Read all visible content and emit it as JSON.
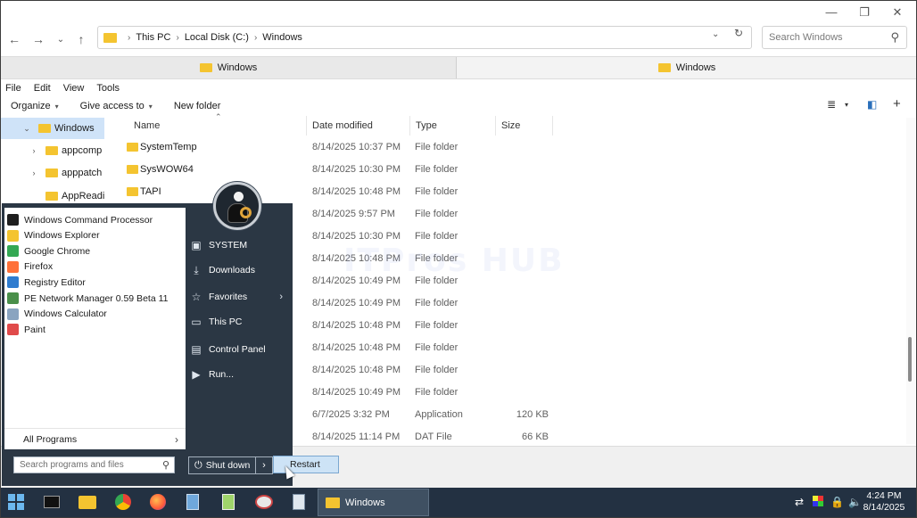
{
  "explorer": {
    "window_controls": [
      "minimize",
      "restore",
      "close"
    ],
    "breadcrumb": [
      "This PC",
      "Local Disk (C:)",
      "Windows"
    ],
    "search_placeholder": "Search Windows",
    "tabs": [
      {
        "label": "Windows",
        "active": true
      },
      {
        "label": "Windows",
        "active": false
      }
    ],
    "menu": [
      "File",
      "Edit",
      "View",
      "Tools"
    ],
    "commands": {
      "organize": "Organize",
      "give_access": "Give access to",
      "new_folder": "New folder"
    },
    "nav_items": [
      {
        "label": "Windows",
        "expanded": true,
        "selected": true
      },
      {
        "label": "appcomp",
        "expanded": false,
        "selected": false
      },
      {
        "label": "apppatch",
        "expanded": false,
        "selected": false
      },
      {
        "label": "AppReadi",
        "expanded": false,
        "selected": false
      }
    ],
    "columns": [
      "Name",
      "Date modified",
      "Type",
      "Size"
    ],
    "rows": [
      {
        "name": "SystemTemp",
        "date": "8/14/2025 10:37 PM",
        "type": "File folder",
        "size": ""
      },
      {
        "name": "SysWOW64",
        "date": "8/14/2025 10:30 PM",
        "type": "File folder",
        "size": ""
      },
      {
        "name": "TAPI",
        "date": "8/14/2025 10:48 PM",
        "type": "File folder",
        "size": ""
      },
      {
        "name": "",
        "date": "8/14/2025 9:57 PM",
        "type": "File folder",
        "size": ""
      },
      {
        "name": "",
        "date": "8/14/2025 10:30 PM",
        "type": "File folder",
        "size": ""
      },
      {
        "name": "",
        "date": "8/14/2025 10:48 PM",
        "type": "File folder",
        "size": ""
      },
      {
        "name": "",
        "date": "8/14/2025 10:49 PM",
        "type": "File folder",
        "size": ""
      },
      {
        "name": "",
        "date": "8/14/2025 10:49 PM",
        "type": "File folder",
        "size": ""
      },
      {
        "name": "",
        "date": "8/14/2025 10:48 PM",
        "type": "File folder",
        "size": ""
      },
      {
        "name": "",
        "date": "8/14/2025 10:48 PM",
        "type": "File folder",
        "size": ""
      },
      {
        "name": "",
        "date": "8/14/2025 10:48 PM",
        "type": "File folder",
        "size": ""
      },
      {
        "name": "",
        "date": "8/14/2025 10:49 PM",
        "type": "File folder",
        "size": ""
      },
      {
        "name": "",
        "date": "6/7/2025 3:32 PM",
        "type": "Application",
        "size": "120 KB"
      },
      {
        "name": "",
        "date": "8/14/2025 11:14 PM",
        "type": "DAT File",
        "size": "66 KB"
      }
    ]
  },
  "start_menu": {
    "programs": [
      {
        "label": "Windows Command Processor",
        "icon": "cmd-icon",
        "color": "#1e1e1e"
      },
      {
        "label": "Windows Explorer",
        "icon": "explorer-icon",
        "color": "#f4c430"
      },
      {
        "label": "Google Chrome",
        "icon": "chrome-icon",
        "color": "#34a853"
      },
      {
        "label": "Firefox",
        "icon": "firefox-icon",
        "color": "#ff7139"
      },
      {
        "label": "Registry Editor",
        "icon": "regedit-icon",
        "color": "#2f7ccf"
      },
      {
        "label": "PE Network Manager 0.59 Beta 11",
        "icon": "network-icon",
        "color": "#4a8f4a"
      },
      {
        "label": "Windows Calculator",
        "icon": "calculator-icon",
        "color": "#8aa4c0"
      },
      {
        "label": "Paint",
        "icon": "paint-icon",
        "color": "#e04a4a"
      }
    ],
    "all_programs": "All Programs",
    "search_placeholder": "Search programs and files",
    "right_items": [
      {
        "label": "SYSTEM",
        "icon": "user-folder-icon"
      },
      {
        "label": "Downloads",
        "icon": "download-icon"
      },
      {
        "label": "Favorites",
        "icon": "star-icon"
      },
      {
        "label": "This PC",
        "icon": "monitor-icon"
      },
      {
        "label": "Control Panel",
        "icon": "control-panel-icon"
      },
      {
        "label": "Run...",
        "icon": "run-icon"
      }
    ],
    "shutdown": "Shut down",
    "restart": "Restart"
  },
  "taskbar": {
    "active_window": "Windows",
    "time": "4:24 PM",
    "date": "8/14/2025"
  },
  "watermark": "ITPros HUB"
}
